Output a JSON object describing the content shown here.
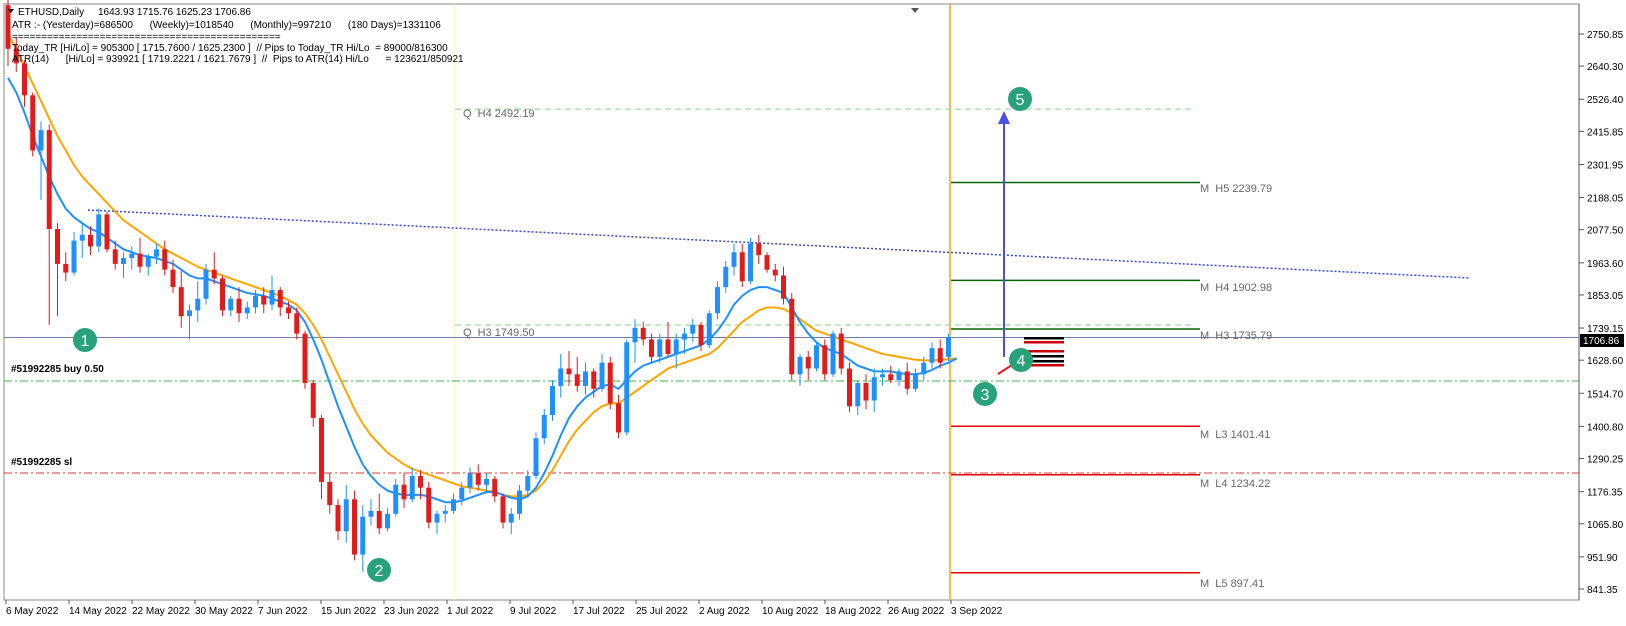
{
  "header": {
    "line1_symbol": "ETHUSD,Daily",
    "line1_values": "1643.93 1715.76 1625.23 1706.86",
    "line2": "ATR :- (Yesterday)=686500      (Weekly)=1018540      (Monthly)=997210      (180 Days)=1331106",
    "line3": "==============================================",
    "line4": "Today_TR [Hi/Lo] = 905300 [ 1715.7600 / 1625.2300 ]  // Pips to Today_TR Hi/Lo  = 89000/816300",
    "line5": "ATR(14)      [Hi/Lo] = 939921 [ 1719.2221 / 1621.7679 ]  //  Pips to ATR(14) Hi/Lo      = 123621/850921"
  },
  "orders": {
    "buy_label": "#51992285 buy 0.50",
    "sl_label": "#51992285 sl"
  },
  "price_axis": {
    "current_price": "1706.86",
    "ticks": [
      "2750.85",
      "2640.30",
      "2526.40",
      "2415.85",
      "2301.95",
      "2188.05",
      "2077.50",
      "1963.60",
      "1853.05",
      "1739.15",
      "1628.60",
      "1514.70",
      "1400.80",
      "1290.25",
      "1176.35",
      "1065.80",
      "951.90",
      "841.35"
    ]
  },
  "time_axis": {
    "labels": [
      "6 May 2022",
      "14 May 2022",
      "22 May 2022",
      "30 May 2022",
      "7 Jun 2022",
      "15 Jun 2022",
      "23 Jun 2022",
      "1 Jul 2022",
      "9 Jul 2022",
      "17 Jul 2022",
      "25 Jul 2022",
      "2 Aug 2022",
      "10 Aug 2022",
      "18 Aug 2022",
      "26 Aug 2022",
      "3 Sep 2022"
    ]
  },
  "levels": {
    "q_h4": "Q  H4 2492.19",
    "q_h3": "Q  H3 1749.50",
    "m_h5": "M  H5 2239.79",
    "m_h4": "M  H4 1902.98",
    "m_h3": "M  H3 1735.79",
    "m_l3": "M  L3 1401.41",
    "m_l4": "M  L4 1234.22",
    "m_l5": "M  L5 897.41"
  },
  "markers": [
    "1",
    "2",
    "3",
    "4",
    "5"
  ],
  "colors": {
    "bull": "#1e90ff",
    "bear": "#e31b1b",
    "ma_fast": "#1e90ff",
    "ma_slow": "#ffa500",
    "trendline": "#3346e6",
    "marker": "#27a27a",
    "resist": "#006400",
    "support": "#e00000"
  },
  "chart_data": {
    "type": "candlestick",
    "symbol": "ETHUSD",
    "timeframe": "Daily",
    "ylim": [
      841.35,
      2790
    ],
    "candles_ohlc": [
      [
        2850,
        2870,
        2640,
        2700
      ],
      [
        2700,
        2740,
        2620,
        2650
      ],
      [
        2650,
        2660,
        2500,
        2540
      ],
      [
        2540,
        2550,
        2330,
        2350
      ],
      [
        2350,
        2450,
        2180,
        2420
      ],
      [
        2420,
        2440,
        1750,
        2080
      ],
      [
        2080,
        2100,
        1780,
        1960
      ],
      [
        1960,
        2000,
        1900,
        1930
      ],
      [
        1930,
        2070,
        1920,
        2040
      ],
      [
        2040,
        2100,
        1980,
        2060
      ],
      [
        2060,
        2090,
        1990,
        2020
      ],
      [
        2020,
        2150,
        2000,
        2130
      ],
      [
        2130,
        2140,
        2000,
        2010
      ],
      [
        2010,
        2040,
        1940,
        1960
      ],
      [
        1960,
        2000,
        1910,
        1980
      ],
      [
        1980,
        2020,
        1940,
        1995
      ],
      [
        1995,
        2050,
        1930,
        1950
      ],
      [
        1950,
        1995,
        1920,
        1985
      ],
      [
        1985,
        2030,
        1960,
        2010
      ],
      [
        2010,
        2040,
        1920,
        1940
      ],
      [
        1940,
        1975,
        1860,
        1880
      ],
      [
        1880,
        1935,
        1740,
        1780
      ],
      [
        1780,
        1820,
        1700,
        1800
      ],
      [
        1800,
        1900,
        1760,
        1840
      ],
      [
        1840,
        1960,
        1820,
        1940
      ],
      [
        1940,
        2000,
        1890,
        1910
      ],
      [
        1910,
        1920,
        1780,
        1800
      ],
      [
        1800,
        1850,
        1780,
        1840
      ],
      [
        1840,
        1880,
        1760,
        1790
      ],
      [
        1790,
        1830,
        1770,
        1810
      ],
      [
        1810,
        1870,
        1790,
        1850
      ],
      [
        1850,
        1880,
        1790,
        1820
      ],
      [
        1820,
        1920,
        1800,
        1870
      ],
      [
        1870,
        1880,
        1780,
        1810
      ],
      [
        1810,
        1830,
        1770,
        1790
      ],
      [
        1790,
        1810,
        1700,
        1720
      ],
      [
        1720,
        1730,
        1530,
        1550
      ],
      [
        1550,
        1560,
        1400,
        1430
      ],
      [
        1430,
        1440,
        1150,
        1210
      ],
      [
        1210,
        1240,
        1100,
        1130
      ],
      [
        1130,
        1150,
        1010,
        1040
      ],
      [
        1040,
        1200,
        1000,
        1150
      ],
      [
        1150,
        1180,
        940,
        960
      ],
      [
        960,
        1130,
        900,
        1090
      ],
      [
        1090,
        1150,
        1060,
        1110
      ],
      [
        1110,
        1170,
        1030,
        1050
      ],
      [
        1050,
        1120,
        1040,
        1100
      ],
      [
        1100,
        1220,
        1090,
        1200
      ],
      [
        1200,
        1240,
        1120,
        1150
      ],
      [
        1150,
        1260,
        1140,
        1230
      ],
      [
        1230,
        1250,
        1150,
        1190
      ],
      [
        1190,
        1210,
        1050,
        1070
      ],
      [
        1070,
        1110,
        1030,
        1100
      ],
      [
        1100,
        1130,
        1070,
        1110
      ],
      [
        1110,
        1170,
        1100,
        1150
      ],
      [
        1150,
        1210,
        1130,
        1190
      ],
      [
        1190,
        1260,
        1170,
        1240
      ],
      [
        1240,
        1270,
        1180,
        1200
      ],
      [
        1200,
        1240,
        1170,
        1220
      ],
      [
        1220,
        1230,
        1140,
        1160
      ],
      [
        1160,
        1170,
        1050,
        1070
      ],
      [
        1070,
        1120,
        1030,
        1100
      ],
      [
        1100,
        1200,
        1080,
        1180
      ],
      [
        1180,
        1250,
        1160,
        1230
      ],
      [
        1230,
        1380,
        1220,
        1360
      ],
      [
        1360,
        1460,
        1340,
        1440
      ],
      [
        1440,
        1560,
        1420,
        1540
      ],
      [
        1540,
        1650,
        1500,
        1600
      ],
      [
        1600,
        1660,
        1540,
        1580
      ],
      [
        1580,
        1640,
        1520,
        1540
      ],
      [
        1540,
        1620,
        1510,
        1590
      ],
      [
        1590,
        1600,
        1500,
        1530
      ],
      [
        1530,
        1650,
        1520,
        1620
      ],
      [
        1620,
        1640,
        1460,
        1480
      ],
      [
        1480,
        1510,
        1360,
        1380
      ],
      [
        1380,
        1700,
        1370,
        1690
      ],
      [
        1690,
        1770,
        1620,
        1740
      ],
      [
        1740,
        1760,
        1680,
        1700
      ],
      [
        1700,
        1720,
        1620,
        1640
      ],
      [
        1640,
        1720,
        1620,
        1700
      ],
      [
        1700,
        1760,
        1640,
        1650
      ],
      [
        1650,
        1720,
        1600,
        1700
      ],
      [
        1700,
        1740,
        1650,
        1720
      ],
      [
        1720,
        1770,
        1690,
        1750
      ],
      [
        1750,
        1760,
        1660,
        1680
      ],
      [
        1680,
        1800,
        1670,
        1790
      ],
      [
        1790,
        1900,
        1770,
        1880
      ],
      [
        1880,
        1970,
        1860,
        1950
      ],
      [
        1950,
        2030,
        1920,
        2000
      ],
      [
        2000,
        2030,
        1880,
        1900
      ],
      [
        1900,
        2050,
        1890,
        2030
      ],
      [
        2030,
        2060,
        1960,
        1990
      ],
      [
        1990,
        2000,
        1930,
        1940
      ],
      [
        1940,
        1960,
        1900,
        1920
      ],
      [
        1920,
        1950,
        1820,
        1840
      ],
      [
        1840,
        1860,
        1560,
        1580
      ],
      [
        1580,
        1650,
        1540,
        1640
      ],
      [
        1640,
        1660,
        1560,
        1600
      ],
      [
        1600,
        1690,
        1590,
        1680
      ],
      [
        1680,
        1700,
        1560,
        1580
      ],
      [
        1580,
        1730,
        1570,
        1720
      ],
      [
        1720,
        1740,
        1580,
        1600
      ],
      [
        1600,
        1620,
        1450,
        1470
      ],
      [
        1470,
        1560,
        1440,
        1550
      ],
      [
        1550,
        1580,
        1460,
        1490
      ],
      [
        1490,
        1600,
        1450,
        1570
      ],
      [
        1570,
        1600,
        1540,
        1580
      ],
      [
        1580,
        1610,
        1550,
        1560
      ],
      [
        1560,
        1600,
        1540,
        1590
      ],
      [
        1590,
        1620,
        1510,
        1530
      ],
      [
        1530,
        1600,
        1520,
        1580
      ],
      [
        1580,
        1640,
        1560,
        1620
      ],
      [
        1620,
        1690,
        1600,
        1670
      ],
      [
        1670,
        1700,
        1600,
        1620
      ],
      [
        1640,
        1720,
        1625,
        1707
      ]
    ],
    "ma_fast_approx": [
      2600,
      2550,
      2480,
      2400,
      2330,
      2260,
      2200,
      2150,
      2120,
      2100,
      2080,
      2070,
      2050,
      2030,
      2010,
      2000,
      1990,
      1985,
      1980,
      1970,
      1960,
      1940,
      1920,
      1910,
      1910,
      1900,
      1890,
      1880,
      1870,
      1860,
      1855,
      1850,
      1840,
      1830,
      1820,
      1800,
      1760,
      1700,
      1630,
      1550,
      1470,
      1400,
      1330,
      1270,
      1230,
      1200,
      1180,
      1170,
      1165,
      1165,
      1165,
      1160,
      1150,
      1140,
      1140,
      1145,
      1155,
      1165,
      1175,
      1175,
      1165,
      1155,
      1150,
      1160,
      1190,
      1240,
      1300,
      1370,
      1430,
      1470,
      1500,
      1520,
      1540,
      1545,
      1530,
      1560,
      1590,
      1610,
      1620,
      1630,
      1640,
      1650,
      1660,
      1670,
      1680,
      1700,
      1730,
      1770,
      1820,
      1850,
      1870,
      1880,
      1880,
      1870,
      1860,
      1810,
      1760,
      1720,
      1690,
      1670,
      1660,
      1650,
      1630,
      1610,
      1600,
      1590,
      1590,
      1590,
      1585,
      1580,
      1580,
      1585,
      1595,
      1610,
      1620,
      1635
    ],
    "ma_slow_approx": [
      2750,
      2700,
      2640,
      2580,
      2520,
      2460,
      2400,
      2350,
      2300,
      2260,
      2230,
      2200,
      2170,
      2140,
      2110,
      2090,
      2070,
      2050,
      2030,
      2010,
      1995,
      1980,
      1965,
      1950,
      1940,
      1930,
      1920,
      1910,
      1900,
      1890,
      1880,
      1870,
      1860,
      1850,
      1835,
      1820,
      1790,
      1750,
      1700,
      1640,
      1580,
      1520,
      1460,
      1410,
      1370,
      1340,
      1310,
      1290,
      1270,
      1255,
      1245,
      1235,
      1225,
      1215,
      1205,
      1195,
      1190,
      1185,
      1180,
      1175,
      1165,
      1160,
      1160,
      1165,
      1180,
      1210,
      1250,
      1300,
      1350,
      1390,
      1420,
      1450,
      1470,
      1480,
      1480,
      1500,
      1520,
      1540,
      1560,
      1580,
      1600,
      1610,
      1620,
      1630,
      1640,
      1650,
      1670,
      1700,
      1730,
      1760,
      1780,
      1800,
      1810,
      1810,
      1805,
      1790,
      1770,
      1750,
      1730,
      1720,
      1710,
      1700,
      1690,
      1680,
      1670,
      1660,
      1650,
      1645,
      1640,
      1635,
      1630,
      1628,
      1628,
      1630,
      1632,
      1634
    ],
    "levels": {
      "Q_H4": 2492.19,
      "Q_H3": 1749.5,
      "M_H5": 2239.79,
      "M_H4": 1902.98,
      "M_H3": 1735.79,
      "M_L3": 1401.41,
      "M_L4": 1234.22,
      "M_L5": 897.41
    },
    "current_price": 1706.86
  }
}
